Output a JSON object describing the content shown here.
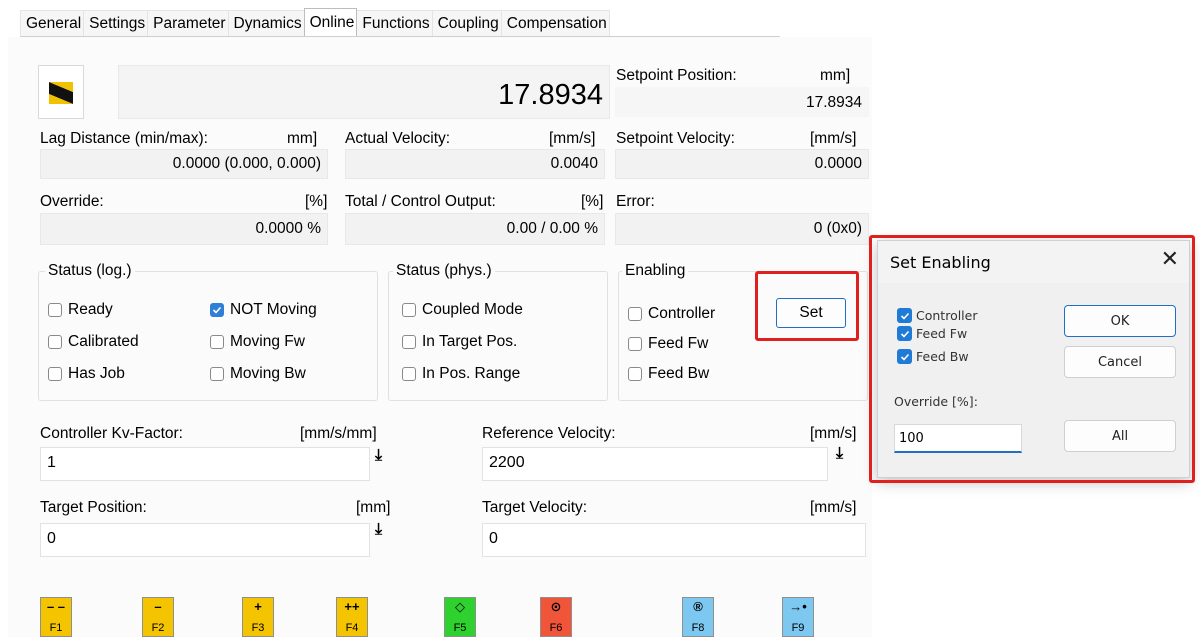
{
  "tabs": [
    "General",
    "Settings",
    "Parameter",
    "Dynamics",
    "Online",
    "Functions",
    "Coupling",
    "Compensation"
  ],
  "active_tab": "Online",
  "position": {
    "value": "17.8934"
  },
  "setpoint_position": {
    "label": "Setpoint Position:",
    "unit": "mm]",
    "value": "17.8934"
  },
  "lag_distance": {
    "label": "Lag Distance (min/max):",
    "unit": "mm]",
    "value": "0.0000  (0.000, 0.000)"
  },
  "actual_velocity": {
    "label": "Actual Velocity:",
    "unit": "[mm/s]",
    "value": "0.0040"
  },
  "setpoint_velocity": {
    "label": "Setpoint Velocity:",
    "unit": "[mm/s]",
    "value": "0.0000"
  },
  "override": {
    "label": "Override:",
    "unit": "[%]",
    "value": "0.0000 %"
  },
  "total_output": {
    "label": "Total / Control Output:",
    "unit": "[%]",
    "value": "0.00 /  0.00 %"
  },
  "error": {
    "label": "Error:",
    "value": "0 (0x0)"
  },
  "status_log": {
    "title": "Status (log.)",
    "items": [
      {
        "label": "Ready",
        "checked": false
      },
      {
        "label": "Calibrated",
        "checked": false
      },
      {
        "label": "Has Job",
        "checked": false
      },
      {
        "label": "NOT Moving",
        "checked": true
      },
      {
        "label": "Moving Fw",
        "checked": false
      },
      {
        "label": "Moving Bw",
        "checked": false
      }
    ]
  },
  "status_phys": {
    "title": "Status (phys.)",
    "items": [
      {
        "label": "Coupled Mode",
        "checked": false
      },
      {
        "label": "In Target Pos.",
        "checked": false
      },
      {
        "label": "In Pos. Range",
        "checked": false
      }
    ]
  },
  "enabling": {
    "title": "Enabling",
    "items": [
      {
        "label": "Controller",
        "checked": false
      },
      {
        "label": "Feed Fw",
        "checked": false
      },
      {
        "label": "Feed Bw",
        "checked": false
      }
    ],
    "set_label": "Set"
  },
  "kv_factor": {
    "label": "Controller Kv-Factor:",
    "unit": "[mm/s/mm]",
    "value": "1"
  },
  "reference_velocity": {
    "label": "Reference Velocity:",
    "unit": "[mm/s]",
    "value": "2200"
  },
  "target_position": {
    "label": "Target Position:",
    "unit": "[mm]",
    "value": "0"
  },
  "target_velocity": {
    "label": "Target Velocity:",
    "unit": "[mm/s]",
    "value": "0"
  },
  "fkeys": [
    {
      "symbol": "– –",
      "name": "F1",
      "color": "#f5c400"
    },
    {
      "symbol": "–",
      "name": "F2",
      "color": "#f5c400"
    },
    {
      "symbol": "+",
      "name": "F3",
      "color": "#f5c400"
    },
    {
      "symbol": "++",
      "name": "F4",
      "color": "#f5c400"
    },
    {
      "symbol": "◇",
      "name": "F5",
      "color": "#2fd12f"
    },
    {
      "symbol": "⊙",
      "name": "F6",
      "color": "#f0553a"
    },
    {
      "symbol": "®",
      "name": "F8",
      "color": "#7cc8f0"
    },
    {
      "symbol": "→•",
      "name": "F9",
      "color": "#7cc8f0"
    }
  ],
  "dialog": {
    "title": "Set Enabling",
    "checkboxes": [
      {
        "label": "Controller",
        "checked": true
      },
      {
        "label": "Feed Fw",
        "checked": true
      },
      {
        "label": "Feed Bw",
        "checked": true
      }
    ],
    "override_label": "Override [%]:",
    "override_value": "100",
    "ok_label": "OK",
    "cancel_label": "Cancel",
    "all_label": "All"
  },
  "colors": {
    "highlight_red": "#e0201f",
    "check_blue": "#2f7fd6"
  }
}
